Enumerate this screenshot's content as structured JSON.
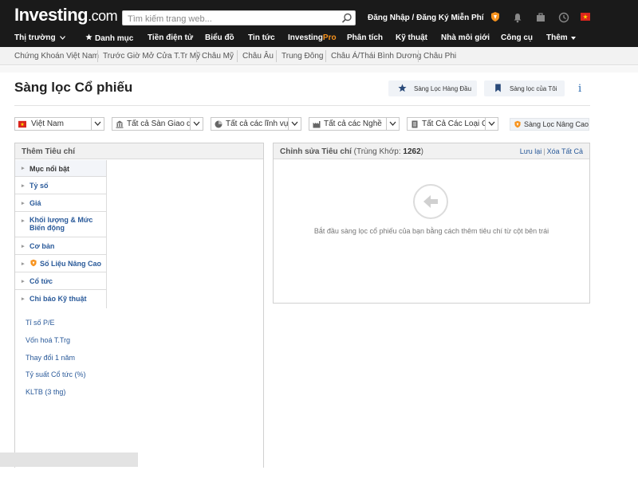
{
  "header": {
    "logo_main": "Investing",
    "logo_suffix": ".com",
    "search_placeholder": "Tìm kiếm trang web...",
    "login_text": "Đăng Nhập / Đăng Ký Miễn Phí"
  },
  "main_nav": [
    {
      "label": "Thị trường",
      "has_dropdown": true
    },
    {
      "label": "Danh mục",
      "icon": "star-icon"
    },
    {
      "label": "Tiền điện tử"
    },
    {
      "label": "Biểu đồ"
    },
    {
      "label": "Tin tức"
    },
    {
      "label": "Investing",
      "pro_suffix": "Pro"
    },
    {
      "label": "Phân tích"
    },
    {
      "label": "Kỹ thuật"
    },
    {
      "label": "Nhà môi giới"
    },
    {
      "label": "Công cụ"
    },
    {
      "label": "Thêm",
      "has_dropdown": true
    }
  ],
  "sub_nav": [
    "Chứng Khoán Việt Nam",
    "Trước Giờ Mở Cửa T.Tr Mỹ",
    "Châu Mỹ",
    "Châu Âu",
    "Trung Đông",
    "Châu Á/Thái Bình Dương",
    "Châu Phi"
  ],
  "page": {
    "title": "Sàng lọc Cổ phiếu",
    "top_screener_button": "Sàng Lọc Hàng Đầu",
    "my_screener_button": "Sàng lọc của Tôi"
  },
  "filters": {
    "country": "Việt Nam",
    "exchange": "Tất cả Sàn Giao dịch",
    "sector": "Tất cả các lĩnh vực",
    "industry": "Tất cả các Nghề",
    "equity_type": "Tất Cả Các Loại Cổ",
    "advanced_button": "Sàng Lọc Nâng Cao"
  },
  "left_panel": {
    "header": "Thêm Tiêu chí",
    "categories": [
      "Mục nổi bật",
      "Tỷ số",
      "Giá",
      "Khối lượng & Mức Biến động",
      "Cơ bản",
      "Số Liệu Nâng Cao",
      "Cổ tức",
      "Chỉ báo Kỹ thuật"
    ],
    "criteria": [
      "Tỉ số P/E",
      "Vốn hoá T.Trg",
      "Thay đổi 1 năm",
      "Tỷ suất Cổ tức (%)",
      "KLTB (3 thg)"
    ]
  },
  "right_panel": {
    "title": "Chỉnh sửa Tiêu chí",
    "match_label": "(Trùng Khớp:",
    "match_count": "1262",
    "match_close": ")",
    "save_link": "Lưu lại",
    "clear_link": "Xóa Tất Cả",
    "empty_message": "Bắt đầu sàng lọc cổ phiếu của bạn bằng cách thêm tiêu chí từ cột bên trái"
  },
  "colors": {
    "header_bg": "#1a1a1a",
    "link_blue": "#2a5a9a",
    "pro_orange": "#f7931e"
  }
}
